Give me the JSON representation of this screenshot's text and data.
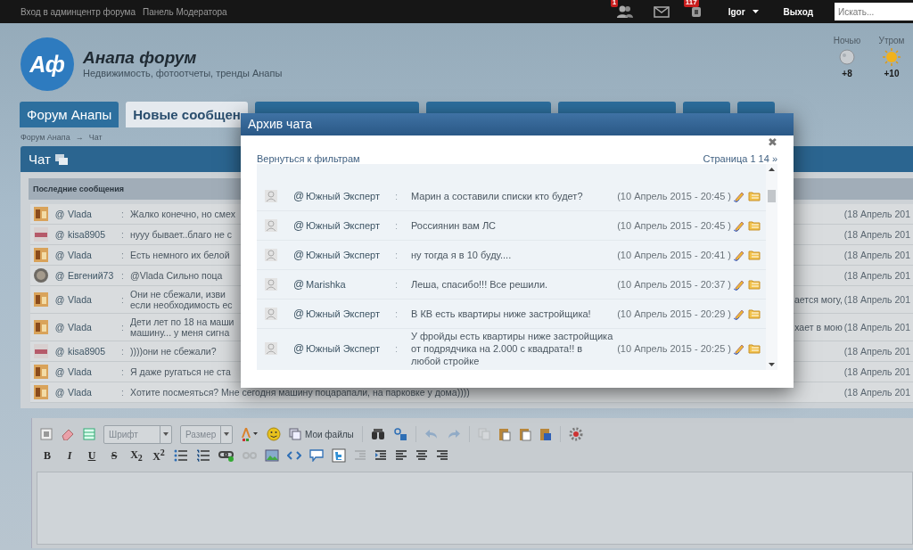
{
  "top_bar": {
    "links": [
      "Вход в админцентр форума",
      "Панель Модератора"
    ],
    "friends_badge": "1",
    "notifications_badge": "117",
    "user": "Igor",
    "logout": "Выход",
    "search": {
      "placeholder": "Искать..."
    }
  },
  "header": {
    "logo": "Аф",
    "title": "Анапа форум",
    "subtitle": "Недвижимость, фотоотчеты, тренды Анапы",
    "weather": [
      {
        "label": "Ночью",
        "kind": "moon",
        "temp": "+8"
      },
      {
        "label": "Утром",
        "kind": "sun",
        "temp": "+10"
      }
    ]
  },
  "nav": [
    {
      "label": "Форум Анапы",
      "selected": false
    },
    {
      "label": "Новые сообщен",
      "selected": true
    },
    {
      "selected": false
    },
    {
      "selected": false
    },
    {
      "selected": false
    },
    {
      "selected": false
    },
    {
      "selected": false
    }
  ],
  "breadcrumb": {
    "items": [
      "Форум Анапа",
      "Чат"
    ],
    "separator": "→"
  },
  "chat": {
    "title": "Чат",
    "subheader": "Последние сообщения",
    "rows": [
      {
        "kind": "orange",
        "at": "@",
        "name": "Vlada",
        "sep": ":",
        "message": "Жалко конечно, но смех",
        "date": "(18 Апрель 201"
      },
      {
        "kind": "pink",
        "at": "@",
        "name": "kisa8905",
        "sep": ":",
        "message": "нууу бывает..благо не с",
        "date": "(18 Апрель 201"
      },
      {
        "kind": "orange",
        "at": "@",
        "name": "Vlada",
        "sep": ":",
        "message": "Есть немного их белой",
        "date": "(18 Апрель 201"
      },
      {
        "kind": "smiley",
        "at": "@",
        "name": "Евгений73",
        "sep": ":",
        "message": "@Vlada Сильно поца",
        "date": "(18 Апрель 201"
      },
      {
        "kind": "orange",
        "at": "@",
        "name": "Vlada",
        "sep": ":",
        "message": "Они не сбежали, изви",
        "message_2": "если необходимость ес",
        "message_end": "ается могу,",
        "date": "(18 Апрель 201"
      },
      {
        "kind": "orange",
        "at": "@",
        "name": "Vlada",
        "sep": ":",
        "message": "Дети лет по 18 на маши",
        "message_2": "машину... у меня сигна",
        "message_end": "хает в мою",
        "date": "(18 Апрель 201"
      },
      {
        "kind": "pink",
        "at": "@",
        "name": "kisa8905",
        "sep": ":",
        "message": "))))они не сбежали?",
        "date": "(18 Апрель 201"
      },
      {
        "kind": "orange",
        "at": "@",
        "name": "Vlada",
        "sep": ":",
        "message": "Я даже ругаться не ста",
        "date": "(18 Апрель 201"
      },
      {
        "kind": "orange",
        "at": "@",
        "name": "Vlada",
        "sep": ":",
        "message": "Хотите посмеяться? Мне сегодня машину поцарапали, на парковке у дома))))",
        "date": "(18 Апрель 201"
      }
    ]
  },
  "modal": {
    "title": "Архив чата",
    "close": "✖",
    "back_link": "Вернуться к фильтрам",
    "pager": "Страница 1 14 »",
    "rows": [
      {
        "at": "@",
        "name": "Южный Эксперт",
        "sep": ":",
        "message": "Марин а составили списки кто будет?",
        "date": "(10 Апрель 2015 - 20:45 )"
      },
      {
        "at": "@",
        "name": "Южный Эксперт",
        "sep": ":",
        "message": "Россиянин вам ЛС",
        "date": "(10 Апрель 2015 - 20:45 )"
      },
      {
        "at": "@",
        "name": "Южный Эксперт",
        "sep": ":",
        "message": "ну тогда я в 10 буду....",
        "date": "(10 Апрель 2015 - 20:41 )"
      },
      {
        "at": "@",
        "name": "Marishka",
        "sep": ":",
        "message": "Леша, спасибо!!! Все решили.",
        "date": "(10 Апрель 2015 - 20:37 )"
      },
      {
        "at": "@",
        "name": "Южный Эксперт",
        "sep": ":",
        "message": "В КВ есть квартиры ниже застройщика!",
        "date": "(10 Апрель 2015 - 20:29 )"
      },
      {
        "at": "@",
        "name": "Южный Эксперт",
        "sep": ":",
        "message": "У фройды есть квартиры ниже застройщика от подрядчика на 2.000 с квадрата!! в любой стройке",
        "date": "(10 Апрель 2015 - 20:25 )"
      }
    ]
  },
  "editor": {
    "font_select": "Шрифт",
    "size_select": "Размер",
    "files_button": "Мои файлы",
    "history_buttons": [
      {
        "kind": "undo",
        "disabled": true
      },
      {
        "kind": "redo",
        "disabled": true
      }
    ],
    "format_buttons": [
      "B",
      "I",
      "U",
      "S",
      "X$_{2}$",
      "X$^{2}$"
    ]
  }
}
